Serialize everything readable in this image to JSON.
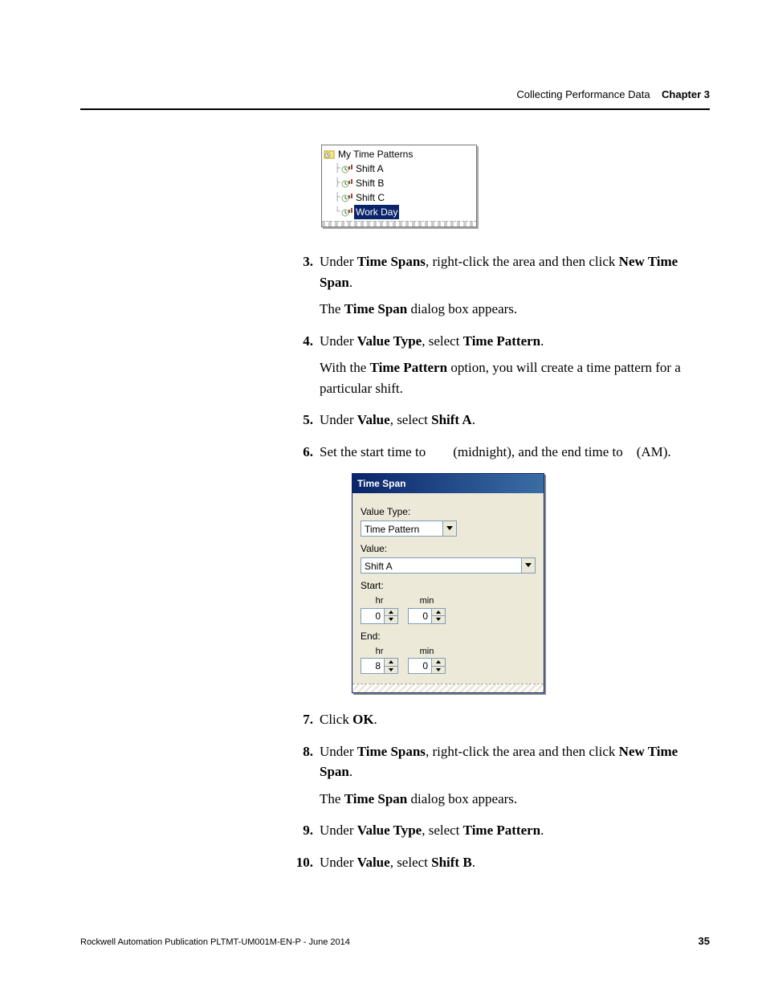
{
  "header": {
    "title": "Collecting Performance Data",
    "chapter": "Chapter 3"
  },
  "tree": {
    "root": "My Time Patterns",
    "children": [
      "Shift A",
      "Shift B",
      "Shift C",
      "Work Day"
    ],
    "selected_index": 3
  },
  "steps": {
    "s3": {
      "line1_a": "Under ",
      "line1_b": "Time Spans",
      "line1_c": ", right-click the area and then click ",
      "line1_d": "New Time Span",
      "line1_e": ".",
      "line2_a": "The ",
      "line2_b": "Time Span",
      "line2_c": " dialog box appears."
    },
    "s4": {
      "line1_a": "Under ",
      "line1_b": "Value Type",
      "line1_c": ", select ",
      "line1_d": "Time Pattern",
      "line1_e": ".",
      "line2_a": "With the ",
      "line2_b": "Time Pattern",
      "line2_c": " option, you will create a time pattern for a particular shift."
    },
    "s5": {
      "line1_a": "Under ",
      "line1_b": "Value",
      "line1_c": ", select ",
      "line1_d": "Shift A",
      "line1_e": "."
    },
    "s6": {
      "line1_a": "Set the start time to ",
      "line1_b": "",
      "line1_c": " (midnight), and the end time to ",
      "line1_d": "",
      "line1_e": " (AM)."
    },
    "s7": {
      "line1_a": "Click ",
      "line1_b": "OK",
      "line1_c": "."
    },
    "s8": {
      "line1_a": "Under ",
      "line1_b": "Time Spans",
      "line1_c": ", right-click the area and then click ",
      "line1_d": "New Time Span",
      "line1_e": ".",
      "line2_a": "The ",
      "line2_b": "Time Span",
      "line2_c": " dialog box appears."
    },
    "s9": {
      "line1_a": "Under ",
      "line1_b": "Value Type",
      "line1_c": ", select ",
      "line1_d": "Time Pattern",
      "line1_e": "."
    },
    "s10": {
      "line1_a": "Under ",
      "line1_b": "Value",
      "line1_c": ", select ",
      "line1_d": "Shift B",
      "line1_e": "."
    }
  },
  "dialog": {
    "title": "Time Span",
    "value_type_label": "Value Type:",
    "value_type_value": "Time Pattern",
    "value_label": "Value:",
    "value_value": "Shift A",
    "start_label": "Start:",
    "end_label": "End:",
    "hr_label": "hr",
    "min_label": "min",
    "start_hr": "0",
    "start_min": "0",
    "end_hr": "8",
    "end_min": "0"
  },
  "footer": {
    "pub": "Rockwell Automation Publication PLTMT-UM001M-EN-P - June 2014",
    "page": "35"
  }
}
